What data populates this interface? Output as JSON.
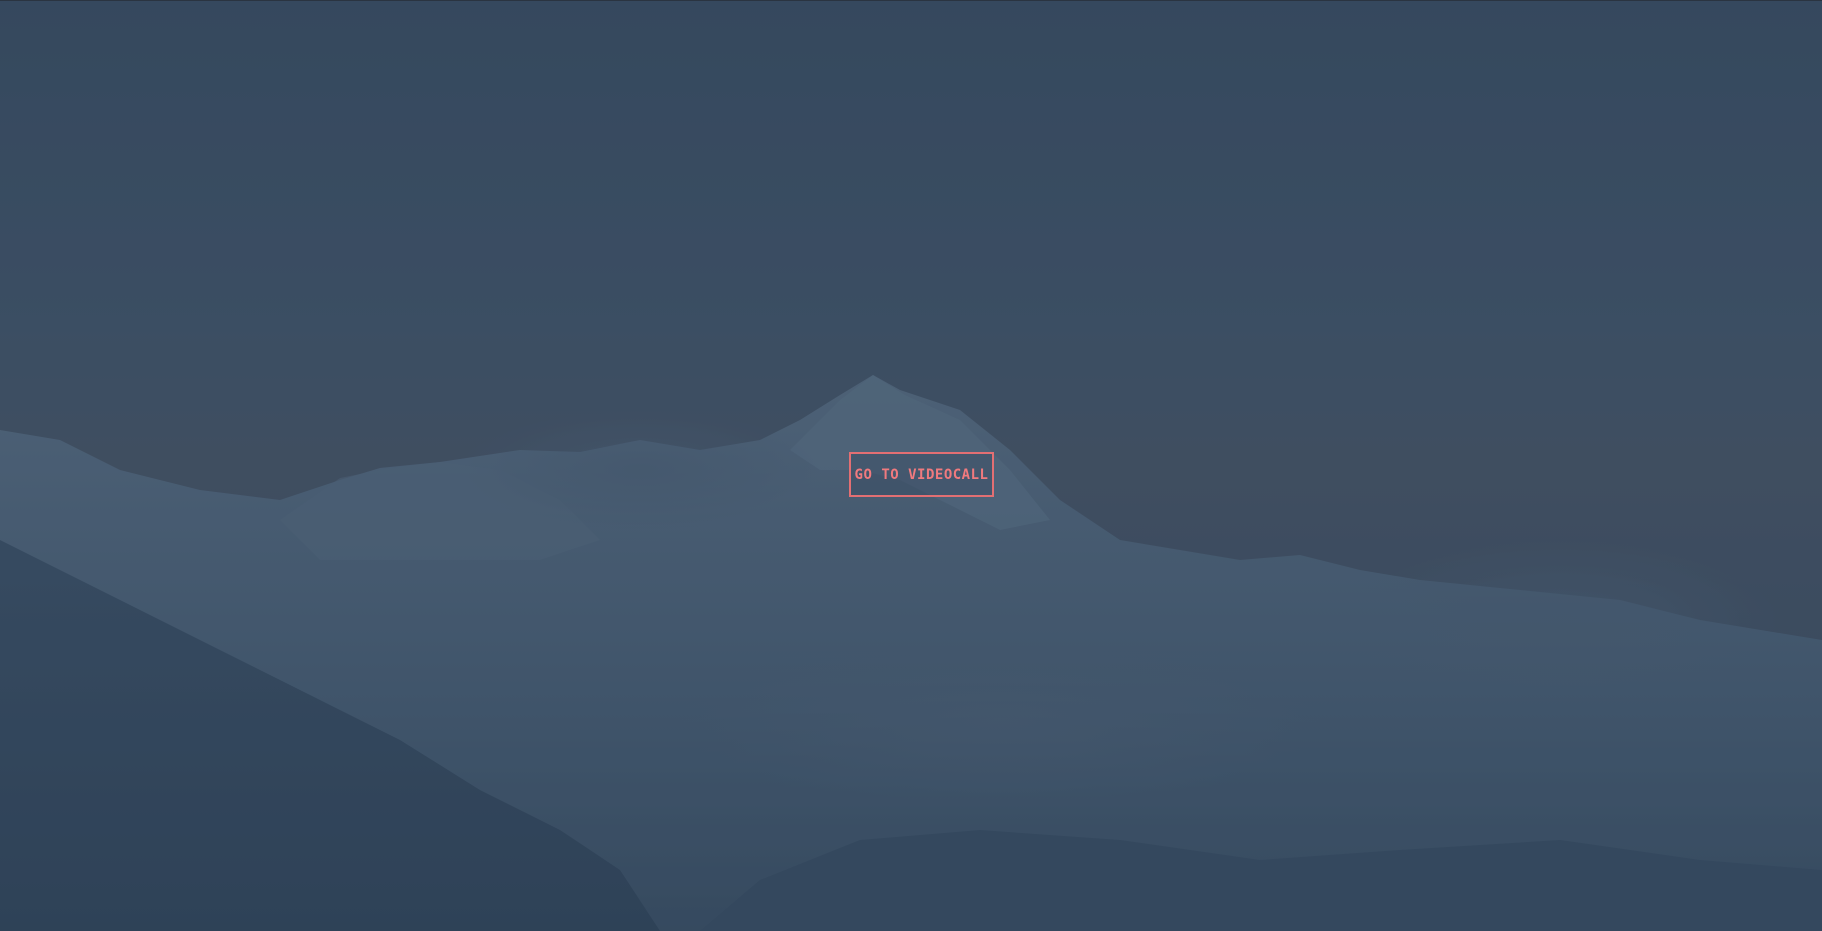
{
  "call_to_action": {
    "label": "GO TO VIDEOCALL",
    "border_color": "#e36f73",
    "text_color": "#f07a7e"
  },
  "background": {
    "description_icon": "mountain-landscape-image",
    "overlay_color": "#34475d"
  }
}
